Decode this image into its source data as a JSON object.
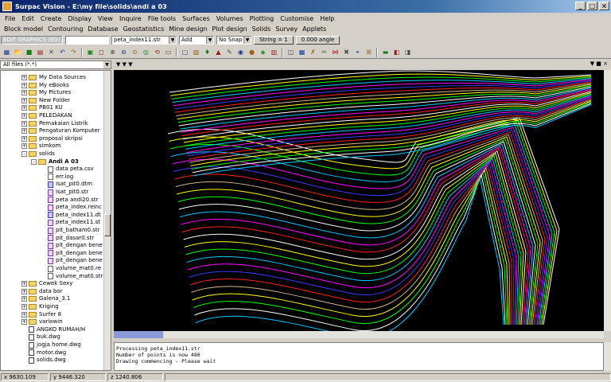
{
  "window": {
    "title": "Surpac Vision - E:\\my file\\solids\\andi a 03",
    "min": "_",
    "max": "□",
    "close": "×"
  },
  "menu_main": [
    "File",
    "Edit",
    "Create",
    "Display",
    "View",
    "Inquire",
    "File tools",
    "Surfaces",
    "Volumes",
    "Plotting",
    "Customise",
    "Help"
  ],
  "menu_modules": [
    "Block model",
    "Contouring",
    "Database",
    "Geostatistics",
    "Mine design",
    "Plot design",
    "Solids",
    "Survey",
    "Applets"
  ],
  "toolbar1": {
    "layer": "EDIT GRAPHICS (EG)",
    "file": "peta_index11.str",
    "mode": "Add",
    "snap": "No Snap",
    "string": "String = 1",
    "angle": "0.000 angle"
  },
  "toolbar_icons": [
    "grid-icon",
    "open-icon",
    "save-icon",
    "print-icon",
    "cancel-icon",
    "undo-icon",
    "redo-icon",
    "layers-icon",
    "window-icon",
    "zoom-in-icon",
    "zoom-out-icon",
    "zoom-window-icon",
    "zoom-extents-icon",
    "reset-icon",
    "view-icon",
    "select-icon",
    "properties-icon",
    "light-icon",
    "lock-icon",
    "draw-icon",
    "shade-icon",
    "point-icon",
    "palette-icon",
    "table-icon",
    "section-icon",
    "grid2-icon",
    "string-edit-icon",
    "trim-icon",
    "join-icon",
    "delete-icon",
    "point-edit-icon",
    "segment-icon",
    "view-plan-icon",
    "view-section-icon",
    "view-3d-icon"
  ],
  "file_filter": "All files (*.*)",
  "tree": [
    {
      "indent": 1,
      "type": "folder",
      "exp": "+",
      "label": "My Data Sources"
    },
    {
      "indent": 1,
      "type": "folder",
      "exp": "+",
      "label": "My eBooks"
    },
    {
      "indent": 1,
      "type": "folder",
      "exp": "+",
      "label": "My Pictures"
    },
    {
      "indent": 1,
      "type": "folder",
      "exp": "+",
      "label": "New Folder"
    },
    {
      "indent": 1,
      "type": "folder",
      "exp": "+",
      "label": "PB01 KU"
    },
    {
      "indent": 1,
      "type": "folder",
      "exp": "+",
      "label": "PELEDAKAN"
    },
    {
      "indent": 1,
      "type": "folder",
      "exp": "+",
      "label": "Pemakaian Listrik"
    },
    {
      "indent": 1,
      "type": "folder",
      "exp": "+",
      "label": "Pengaturan Komputer"
    },
    {
      "indent": 1,
      "type": "folder",
      "exp": "+",
      "label": "proposal skripsi"
    },
    {
      "indent": 1,
      "type": "folder",
      "exp": "+",
      "label": "simkom"
    },
    {
      "indent": 1,
      "type": "folder",
      "exp": "-",
      "label": "solids"
    },
    {
      "indent": 2,
      "type": "folder",
      "exp": "-",
      "label": "Andi A 03",
      "bold": true
    },
    {
      "indent": 3,
      "type": "file",
      "exp": "",
      "label": "data peta.csv"
    },
    {
      "indent": 3,
      "type": "file",
      "exp": "",
      "label": "err.log"
    },
    {
      "indent": 3,
      "type": "dtm",
      "exp": "",
      "label": "Isat_pit0.dtm"
    },
    {
      "indent": 3,
      "type": "str",
      "exp": "",
      "label": "Isat_pit0.str"
    },
    {
      "indent": 3,
      "type": "str",
      "exp": "",
      "label": "peta andi20.str"
    },
    {
      "indent": 3,
      "type": "str",
      "exp": "",
      "label": "peta_index.reinc"
    },
    {
      "indent": 3,
      "type": "dtm",
      "exp": "",
      "label": "peta_index11.dt"
    },
    {
      "indent": 3,
      "type": "str",
      "exp": "",
      "label": "peta_index11.st"
    },
    {
      "indent": 3,
      "type": "str",
      "exp": "",
      "label": "pit_batham0.str"
    },
    {
      "indent": 3,
      "type": "str",
      "exp": "",
      "label": "pit_dasar0.str"
    },
    {
      "indent": 3,
      "type": "str",
      "exp": "",
      "label": "pit_dengan bene"
    },
    {
      "indent": 3,
      "type": "str",
      "exp": "",
      "label": "pit_dengan bene"
    },
    {
      "indent": 3,
      "type": "str",
      "exp": "",
      "label": "pit_dengan bene"
    },
    {
      "indent": 3,
      "type": "file",
      "exp": "",
      "label": "volume_mat0.re"
    },
    {
      "indent": 3,
      "type": "file",
      "exp": "",
      "label": "volume_mat0.str"
    },
    {
      "indent": 1,
      "type": "folder",
      "exp": "+",
      "label": "Cewek Sexy"
    },
    {
      "indent": 1,
      "type": "folder",
      "exp": "+",
      "label": "data bor"
    },
    {
      "indent": 1,
      "type": "folder",
      "exp": "+",
      "label": "Galena_3.1"
    },
    {
      "indent": 1,
      "type": "folder",
      "exp": "+",
      "label": "Kriging"
    },
    {
      "indent": 1,
      "type": "folder",
      "exp": "+",
      "label": "Surfer 8"
    },
    {
      "indent": 1,
      "type": "folder",
      "exp": "+",
      "label": "variowin"
    },
    {
      "indent": 1,
      "type": "dwg",
      "exp": "",
      "label": "ANGKO RUMAH/H"
    },
    {
      "indent": 1,
      "type": "dwg",
      "exp": "",
      "label": "buk.dwg"
    },
    {
      "indent": 1,
      "type": "dwg",
      "exp": "",
      "label": "jogja home.dwg"
    },
    {
      "indent": 1,
      "type": "dwg",
      "exp": "",
      "label": "motor.dwg"
    },
    {
      "indent": 1,
      "type": "dwg",
      "exp": "",
      "label": "solids.dwg"
    }
  ],
  "messages": [
    "Processing peta_index11.str",
    "Number of points is now 480",
    "Drawing commencing - Please wait"
  ],
  "status": {
    "x": "x 9630.109",
    "y": "y 9446.320",
    "z": "z 1240.806"
  },
  "colors": {
    "titlebar": "#0a246a",
    "graphics_bg": "#000000",
    "contours": [
      "#ffffff",
      "#ffff00",
      "#00ff00",
      "#00c8ff",
      "#ff00ff",
      "#3a3aff",
      "#ff2020",
      "#d2b48c"
    ]
  }
}
